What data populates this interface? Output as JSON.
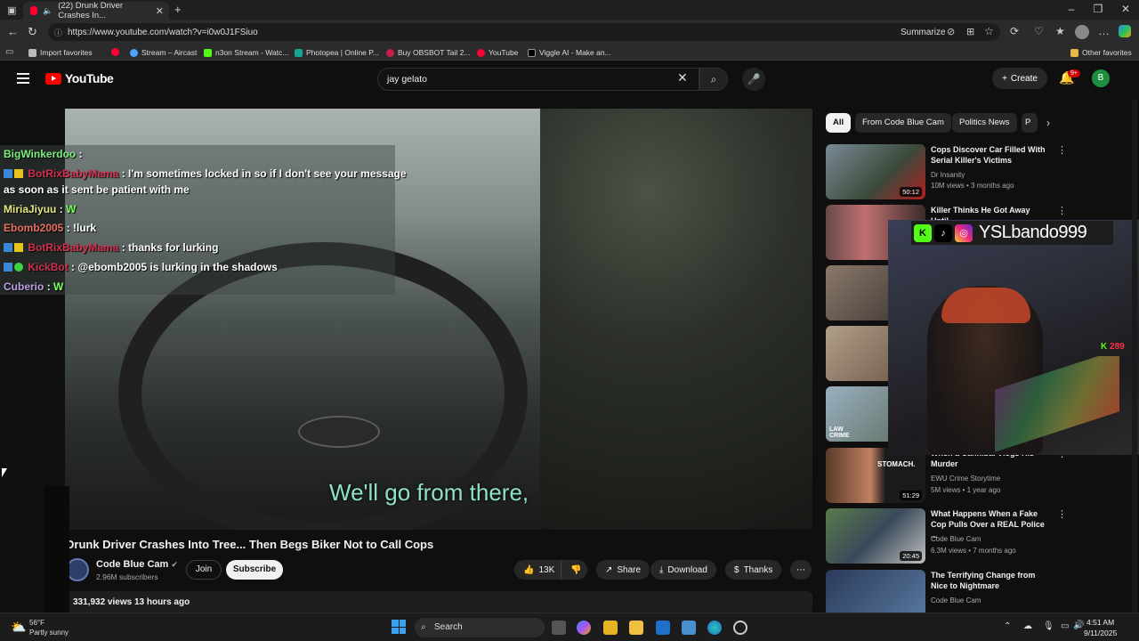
{
  "browser": {
    "tab_title": "(22) Drunk Driver Crashes In...",
    "url": "https://www.youtube.com/watch?v=i0w0J1FSiuo",
    "summarize": "Summarize",
    "bookmarks": [
      "Import favorites",
      "Stream – Aircast",
      "n3on Stream - Watc...",
      "Photopea | Online P...",
      "Buy OBSBOT Tail 2...",
      "YouTube",
      "Viggle AI - Make an..."
    ],
    "other_favorites": "Other favorites"
  },
  "youtube": {
    "logo": "YouTube",
    "search_value": "jay gelato",
    "create": "Create",
    "notif_count": "9+",
    "avatar_letter": "B"
  },
  "chat": [
    {
      "name": "BigWinkerdoo",
      "text": ":",
      "color": "#7cf07c"
    },
    {
      "name": "BotRixBabyMama",
      "text": ": I'm sometimes locked in so if I don't see your message",
      "color": "#d33050"
    },
    {
      "name": "",
      "text": "as soon as it sent be patient with me",
      "color": ""
    },
    {
      "name": "MiriaJiyuu",
      "text": ":",
      "color": "#e8e880",
      "emote": "W"
    },
    {
      "name": "Ebomb2005",
      "text": ": !lurk",
      "color": "#e87060"
    },
    {
      "name": "BotRixBabyMama",
      "text": ": thanks for lurking",
      "color": "#d33050"
    },
    {
      "name": "KickBot",
      "text": ": @ebomb2005 is lurking in the shadows",
      "color": "#d33050"
    },
    {
      "name": "Cuberio",
      "text": ":",
      "color": "#c0a0e0",
      "emote": "W"
    }
  ],
  "video": {
    "subtitle": "We'll go from there,",
    "title": "Drunk Driver Crashes Into Tree... Then Begs Biker Not to Call Cops",
    "channel": "Code Blue Cam",
    "subscribers": "2.96M subscribers",
    "join": "Join",
    "subscribe": "Subscribe",
    "likes": "13K",
    "share": "Share",
    "download": "Download",
    "thanks": "Thanks",
    "views_line": "331,932 views  13 hours ago"
  },
  "chips": [
    "All",
    "From Code Blue Cam",
    "Politics News",
    "P"
  ],
  "recommendations": [
    {
      "title": "Cops Discover Car Filled With Serial Killer's Victims",
      "channel": "Dr Insanity",
      "meta": "10M views • 3 months ago",
      "duration": "50:12"
    },
    {
      "title": "Killer Thinks He Got Away Until",
      "channel": "",
      "meta": "",
      "duration": ""
    },
    {
      "title": "",
      "channel": "",
      "meta": "",
      "duration": ""
    },
    {
      "title": "",
      "channel": "",
      "meta": "",
      "duration": ""
    },
    {
      "title": "",
      "channel": "",
      "meta": "",
      "duration": ""
    },
    {
      "title": "When a Cannibal Vlogs His Murder",
      "channel": "EWU Crime Storytime",
      "meta": "5M views • 1 year ago",
      "duration": "51:29"
    },
    {
      "title": "What Happens When a Fake Cop Pulls Over a REAL Police ...",
      "channel": "Code Blue Cam",
      "meta": "6.3M views • 7 months ago",
      "duration": "20:45"
    },
    {
      "title": "The Terrifying Change from Nice to Nightmare",
      "channel": "Code Blue Cam",
      "meta": "",
      "duration": ""
    }
  ],
  "stream_overlay": {
    "handle": "YSLbando999",
    "kick_count": "289"
  },
  "taskbar": {
    "weather_temp": "56°F",
    "weather_desc": "Partly sunny",
    "search": "Search",
    "time": "4:51 AM",
    "date": "9/11/2025"
  }
}
